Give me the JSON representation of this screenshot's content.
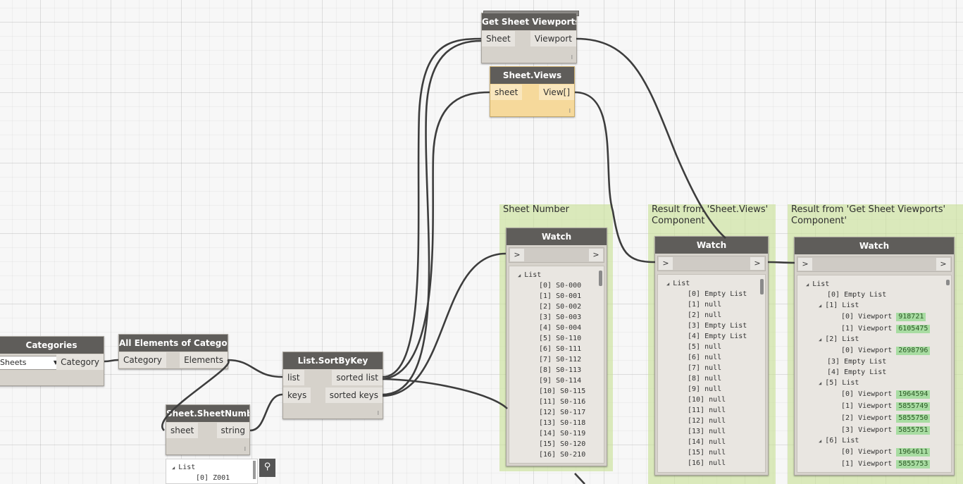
{
  "groups": {
    "sheet_number": {
      "title": "Sheet Number"
    },
    "sheet_views": {
      "title_line1": "Result from 'Sheet.Views'",
      "title_line2": "Component"
    },
    "get_viewports": {
      "title_line1": "Result from 'Get Sheet Viewports'",
      "title_line2": "Component'"
    }
  },
  "nodes": {
    "categories": {
      "title": "Categories",
      "dropdown_value": "Sheets",
      "output": "Category"
    },
    "all_elements": {
      "title": "All Elements of Category",
      "input": "Category",
      "output": "Elements"
    },
    "sheet_number": {
      "title": "Sheet.SheetNumber",
      "input": "sheet",
      "output": "string",
      "foot": "l"
    },
    "sort_by_key": {
      "title": "List.SortByKey",
      "input_list": "list",
      "input_keys": "keys",
      "output_sorted": "sorted list",
      "output_keys": "sorted keys",
      "foot": "l"
    },
    "get_viewports": {
      "title": "Get Sheet Viewports",
      "input": "Sheet",
      "output": "Viewport",
      "foot": "l"
    },
    "sheet_views": {
      "title": "Sheet.Views",
      "input": "sheet",
      "output": "View[]",
      "foot": "l"
    }
  },
  "watch_common": {
    "title": "Watch",
    "in_arrow": ">",
    "out_arrow": ">",
    "root": "List"
  },
  "watch_sheet_number": {
    "items": [
      "[0] S0-000",
      "[1] S0-001",
      "[2] S0-002",
      "[3] S0-003",
      "[4] S0-004",
      "[5] S0-110",
      "[6] S0-111",
      "[7] S0-112",
      "[8] S0-113",
      "[9] S0-114",
      "[10] S0-115",
      "[11] S0-116",
      "[12] S0-117",
      "[13] S0-118",
      "[14] S0-119",
      "[15] S0-120",
      "[16] S0-210"
    ]
  },
  "watch_sheet_views": {
    "items": [
      "[0] Empty List",
      "[1] null",
      "[2] null",
      "[3] Empty List",
      "[4] Empty List",
      "[5] null",
      "[6] null",
      "[7] null",
      "[8] null",
      "[9] null",
      "[10] null",
      "[11] null",
      "[12] null",
      "[13] null",
      "[14] null",
      "[15] null",
      "[16] null"
    ]
  },
  "watch_viewports": {
    "i0": "[0] Empty List",
    "l1": "[1] List",
    "l1_0": "[0] Viewport",
    "l1_0_v": "918721",
    "l1_1": "[1] Viewport",
    "l1_1_v": "6105475",
    "l2": "[2] List",
    "l2_0": "[0] Viewport",
    "l2_0_v": "2698796",
    "i3": "[3] Empty List",
    "i4": "[4] Empty List",
    "l5": "[5] List",
    "l5_0": "[0] Viewport",
    "l5_0_v": "1964594",
    "l5_1": "[1] Viewport",
    "l5_1_v": "5855749",
    "l5_2": "[2] Viewport",
    "l5_2_v": "5855750",
    "l5_3": "[3] Viewport",
    "l5_3_v": "5855751",
    "l6": "[6] List",
    "l6_0": "[0] Viewport",
    "l6_0_v": "1964611",
    "l6_1": "[1] Viewport",
    "l6_1_v": "5855753"
  },
  "preview": {
    "root": "List",
    "item0": "[0] Z001"
  },
  "icons": {
    "pin": "pin-icon",
    "dropdown": "chevron-down-icon",
    "expand": "triangle-expanded-icon"
  },
  "colors": {
    "node_header": "#5f5d5a",
    "node_body": "#d6d2cb",
    "selected_node": "#f6d99b",
    "group_fill": "#c8e096",
    "value_badge": "#a8dca2"
  }
}
